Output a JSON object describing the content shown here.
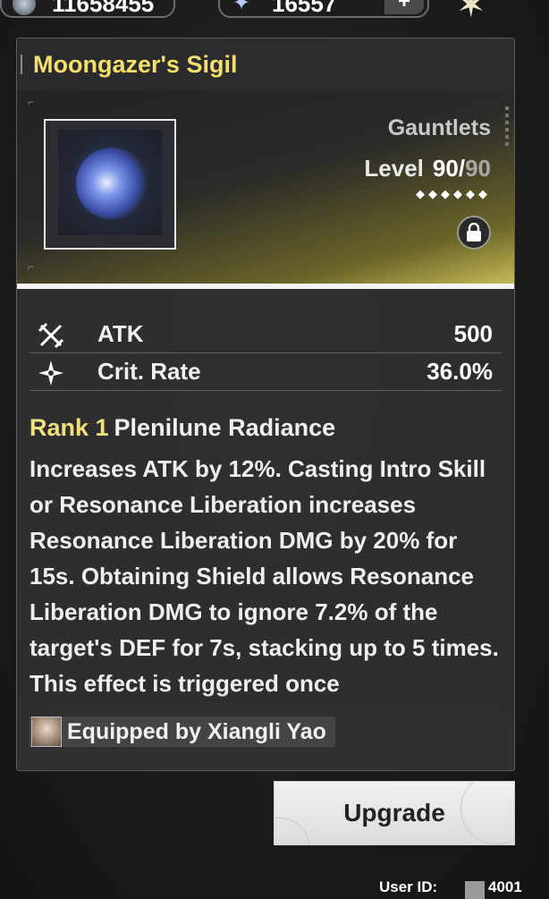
{
  "currency": {
    "primary_icon": "shell-credit-icon",
    "primary_value": "11658455",
    "secondary_icon": "astrite-star-icon",
    "secondary_value": "16557",
    "add_label": "+"
  },
  "top_icon": "resonator-star-emblem-icon",
  "weapon": {
    "name": "Moongazer's Sigil",
    "type": "Gauntlets",
    "level_label": "Level",
    "level_current": "90",
    "level_sep": "/",
    "level_max": "90",
    "rank_diamonds": "◆◆◆◆◆◆",
    "locked": true
  },
  "stats": [
    {
      "icon": "atk-swords-icon",
      "name": "ATK",
      "value": "500"
    },
    {
      "icon": "crit-star-icon",
      "name": "Crit. Rate",
      "value": "36.0%"
    }
  ],
  "passive": {
    "rank": "Rank 1",
    "name": "Plenilune Radiance",
    "description": "Increases ATK by 12%. Casting Intro Skill or Resonance Liberation increases Resonance Liberation DMG by 20% for 15s. Obtaining Shield allows Resonance Liberation DMG to ignore 7.2% of the target's DEF for 7s, stacking up to 5 times. This effect is triggered once"
  },
  "equipped": {
    "label": "Equipped by Xiangli Yao"
  },
  "actions": {
    "upgrade_label": "Upgrade"
  },
  "footer": {
    "uid_label": "User ID:",
    "uid_value": "4001"
  }
}
